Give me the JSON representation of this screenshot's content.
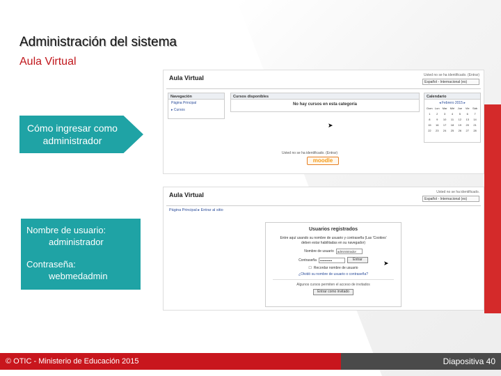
{
  "slide": {
    "title": "Administración del sistema",
    "subtitle": "Aula Virtual",
    "callout": "Cómo ingresar como administrador",
    "credentials": {
      "user_label": "Nombre de usuario:",
      "user_value": "administrador",
      "pass_label": "Contraseña:",
      "pass_value": "webmedadmin"
    },
    "footer_left": "© OTIC - Ministerio de Educación 2015",
    "footer_right": "Diapositiva 40"
  },
  "shot1": {
    "logo": "Aula Virtual",
    "login_line": "Usted no se ha identificado. (Entrar)",
    "lang": "Español - Internacional (es)",
    "nav_title": "Navegación",
    "nav_home": "Página Principal",
    "nav_courses": "▸ Cursos",
    "courses_title": "Cursos disponibles",
    "no_courses": "No hay cursos en esta categoría",
    "cal_title": "Calendario",
    "cal_month": "◂ Febrero 2015 ▸",
    "cal_days": [
      "Dom",
      "Lun",
      "Mar",
      "Mié",
      "Jue",
      "Vie",
      "Sáb"
    ],
    "cal_dates": [
      "1",
      "2",
      "3",
      "4",
      "5",
      "6",
      "7",
      "8",
      "9",
      "10",
      "11",
      "12",
      "13",
      "14",
      "15",
      "16",
      "17",
      "18",
      "19",
      "20",
      "21",
      "22",
      "23",
      "24",
      "25",
      "26",
      "27",
      "28"
    ],
    "footer_line": "Usted no se ha identificado. (Entrar)",
    "moodle": "moodle"
  },
  "shot2": {
    "logo": "Aula Virtual",
    "login_line": "Usted no se ha identificado.",
    "lang": "Español - Internacional (es)",
    "crumbs": "Página Principal ▸ Entrar al sitio",
    "panel_title": "Usuarios registrados",
    "panel_text": "Entre aquí usando su nombre de usuario y contraseña (Las 'Cookies' deben estar habilitadas en su navegador)",
    "username_label": "Nombre de usuario",
    "username_value": "administrador",
    "password_label": "Contraseña",
    "password_value": "•••••••••••",
    "login_button": "Entrar",
    "remember": "Recordar nombre de usuario",
    "forgot": "¿Olvidó su nombre de usuario o contraseña?",
    "guest_text": "Algunos cursos permiten el acceso de invitados",
    "guest_button": "Entrar como invitado"
  },
  "icons": {
    "cursor": "mouse-cursor-icon",
    "checkbox": "checkbox-icon"
  },
  "colors": {
    "teal": "#1fa3a5",
    "red": "#c8161d",
    "dark": "#4a4a4a"
  }
}
